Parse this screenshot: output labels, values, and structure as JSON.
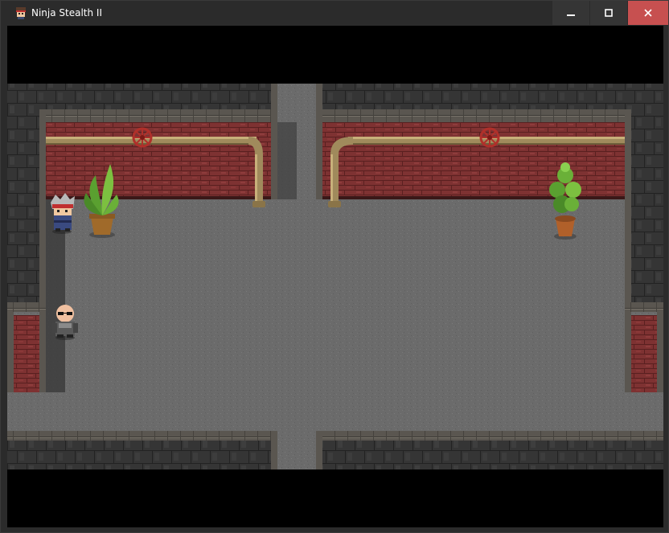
{
  "window": {
    "title": "Ninja Stealth II",
    "icon": "ninja-face-icon",
    "controls": [
      "minimize-icon",
      "maximize-icon",
      "close-icon"
    ]
  },
  "colors": {
    "titlebar": "#2b2b2b",
    "close_hover": "#c75050",
    "floor": "#6b6b6b",
    "brick": "#8a3535",
    "stone_wall": "#3a3a3a",
    "pipe": "#a08a5c",
    "valve": "#b0302a",
    "letterbox": "#000000"
  },
  "scene": {
    "characters": [
      {
        "name": "ninja-player",
        "role": "player"
      },
      {
        "name": "bald-guard",
        "role": "guard"
      }
    ],
    "props": [
      "potted-plant-left",
      "potted-plant-right",
      "pipe-left",
      "pipe-right",
      "valve-left",
      "valve-right"
    ]
  }
}
